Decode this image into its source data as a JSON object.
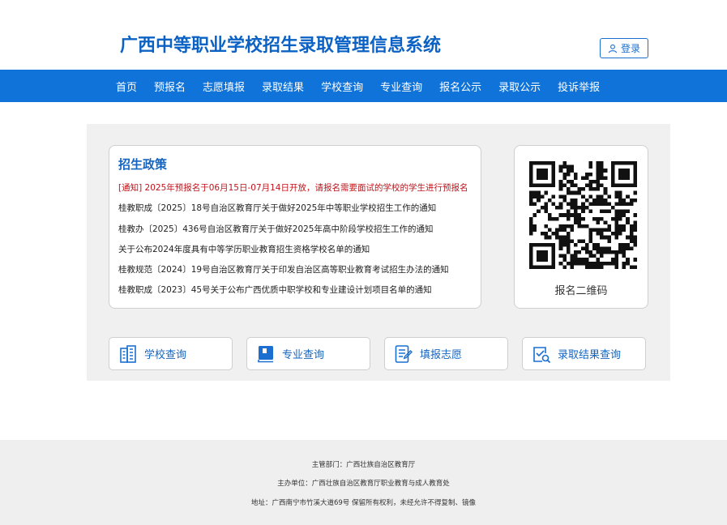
{
  "header": {
    "title": "广西中等职业学校招生录取管理信息系统",
    "login_label": "登录"
  },
  "nav": {
    "items": [
      "首页",
      "预报名",
      "志愿填报",
      "录取结果",
      "学校查询",
      "专业查询",
      "报名公示",
      "录取公示",
      "投诉举报"
    ]
  },
  "policy": {
    "title": "招生政策",
    "items": [
      "[通知] 2025年预报名于06月15日-07月14日开放，请报名需要面试的学校的学生进行预报名",
      "桂教职成〔2025〕18号自治区教育厅关于做好2025年中等职业学校招生工作的通知",
      "桂教办〔2025〕436号自治区教育厅关于做好2025年高中阶段学校招生工作的通知",
      "关于公布2024年度具有中等学历职业教育招生资格学校名单的通知",
      "桂教规范〔2024〕19号自治区教育厅关于印发自治区高等职业教育考试招生办法的通知",
      "桂教职成〔2023〕45号关于公布广西优质中职学校和专业建设计划项目名单的通知"
    ]
  },
  "qr": {
    "caption": "报名二维码"
  },
  "quick_links": {
    "school": "学校查询",
    "major": "专业查询",
    "apply": "填报志愿",
    "result": "录取结果查询"
  },
  "footer": {
    "line1": "主管部门：广西壮族自治区教育厅",
    "line2": "主办单位：广西壮族自治区教育厅职业教育与成人教育处",
    "line3": "地址：广西南宁市竹溪大道69号 保留所有权利，未经允许不得复制、镜像"
  },
  "colors": {
    "brand": "#0f73d9",
    "title": "#0b62c4",
    "notice": "#c0141b"
  }
}
